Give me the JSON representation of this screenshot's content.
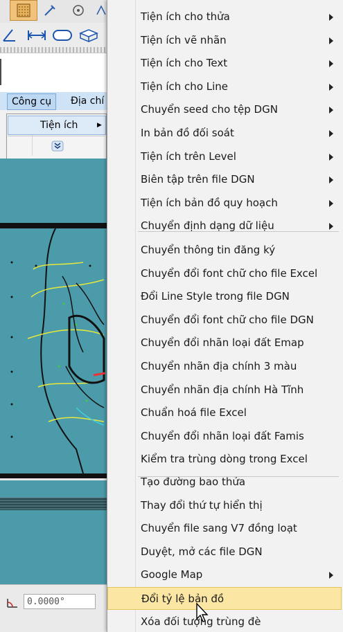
{
  "background": {
    "menubar": {
      "active_menu": "Công cụ",
      "next_menu": "Địa chí"
    },
    "submenu": {
      "item_label": "Tiện ích"
    },
    "statusbar": {
      "angle_value": "0.0000°"
    }
  },
  "context_menu": {
    "items": [
      {
        "label": "Tiện ích cho thửa",
        "has_submenu": true
      },
      {
        "label": "Tiện ích vẽ nhãn",
        "has_submenu": true
      },
      {
        "label": "Tiện ích cho Text",
        "has_submenu": true
      },
      {
        "label": "Tiện ích cho Line",
        "has_submenu": true
      },
      {
        "label": "Chuyển seed cho tệp DGN",
        "has_submenu": true
      },
      {
        "label": "In bản đồ đối soát",
        "has_submenu": true
      },
      {
        "label": "Tiện ích trên Level",
        "has_submenu": true
      },
      {
        "label": "Biên tập trên file DGN",
        "has_submenu": true
      },
      {
        "label": "Tiện ích bản đồ quy hoạch",
        "has_submenu": true
      },
      {
        "label": "Chuyển định dạng dữ liệu",
        "has_submenu": true
      },
      {
        "label": "Chuyển thông tin đăng ký",
        "has_submenu": false
      },
      {
        "label": "Chuyển đổi font chữ cho file Excel",
        "has_submenu": false
      },
      {
        "label": "Đổi Line Style trong file DGN",
        "has_submenu": false
      },
      {
        "label": "Chuyển đổi font chữ cho file DGN",
        "has_submenu": false
      },
      {
        "label": "Chuyển đổi nhãn loại đất Emap",
        "has_submenu": false
      },
      {
        "label": "Chuyển nhãn địa chính 3 màu",
        "has_submenu": false
      },
      {
        "label": "Chuyển nhãn địa chính Hà Tĩnh",
        "has_submenu": false
      },
      {
        "label": "Chuẩn hoá file Excel",
        "has_submenu": false
      },
      {
        "label": "Chuyển đổi nhãn loại đất Famis",
        "has_submenu": false
      },
      {
        "label": "Kiểm tra trùng dòng trong Excel",
        "has_submenu": false
      },
      {
        "label": "Tạo đường bao thửa",
        "has_submenu": false
      },
      {
        "label": "Thay đổi thứ tự hiển thị",
        "has_submenu": false
      },
      {
        "label": "Chuyển file sang V7 đồng loạt",
        "has_submenu": false
      },
      {
        "label": "Duyệt, mở các file DGN",
        "has_submenu": false
      },
      {
        "label": "Google Map",
        "has_submenu": true
      },
      {
        "label": "Đổi tỷ lệ bản đồ",
        "has_submenu": false,
        "highlighted": true
      },
      {
        "label": "Xóa đối tượng trùng đè",
        "has_submenu": false
      }
    ]
  },
  "colors": {
    "highlight": "#fbe7a3",
    "canvas": "#4c9bab",
    "menubar": "#cfe3f7"
  }
}
